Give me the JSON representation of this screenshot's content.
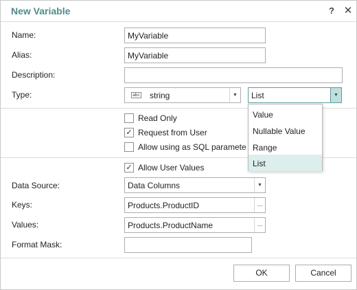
{
  "dialog": {
    "title": "New Variable",
    "help_glyph": "?",
    "close_glyph": "✕"
  },
  "form": {
    "name": {
      "label": "Name:",
      "value": "MyVariable"
    },
    "alias": {
      "label": "Alias:",
      "value": "MyVariable"
    },
    "description": {
      "label": "Description:",
      "value": ""
    },
    "type": {
      "label": "Type:",
      "icon_text": "abc",
      "value": "string",
      "list_value": "List"
    }
  },
  "options": {
    "read_only": {
      "label": "Read Only",
      "checked": false
    },
    "request_from_user": {
      "label": "Request from User",
      "checked": true
    },
    "allow_sql": {
      "label": "Allow using as SQL paramete",
      "checked": false
    }
  },
  "dropdown": {
    "items": [
      "Value",
      "Nullable Value",
      "Range",
      "List"
    ],
    "selected": "List"
  },
  "data": {
    "allow_user_values": {
      "label": "Allow User Values",
      "checked": true
    },
    "data_source": {
      "label": "Data Source:",
      "value": "Data Columns"
    },
    "keys": {
      "label": "Keys:",
      "value": "Products.ProductID"
    },
    "values": {
      "label": "Values:",
      "value": "Products.ProductName"
    },
    "format_mask": {
      "label": "Format Mask:",
      "value": ""
    }
  },
  "buttons": {
    "ok": "OK",
    "cancel": "Cancel",
    "ellipsis": "..."
  },
  "colors": {
    "title": "#4f8b8b",
    "accent_border": "#5a9e9c",
    "accent_fill": "#bfe0dc",
    "selected_item": "#dcefed"
  }
}
